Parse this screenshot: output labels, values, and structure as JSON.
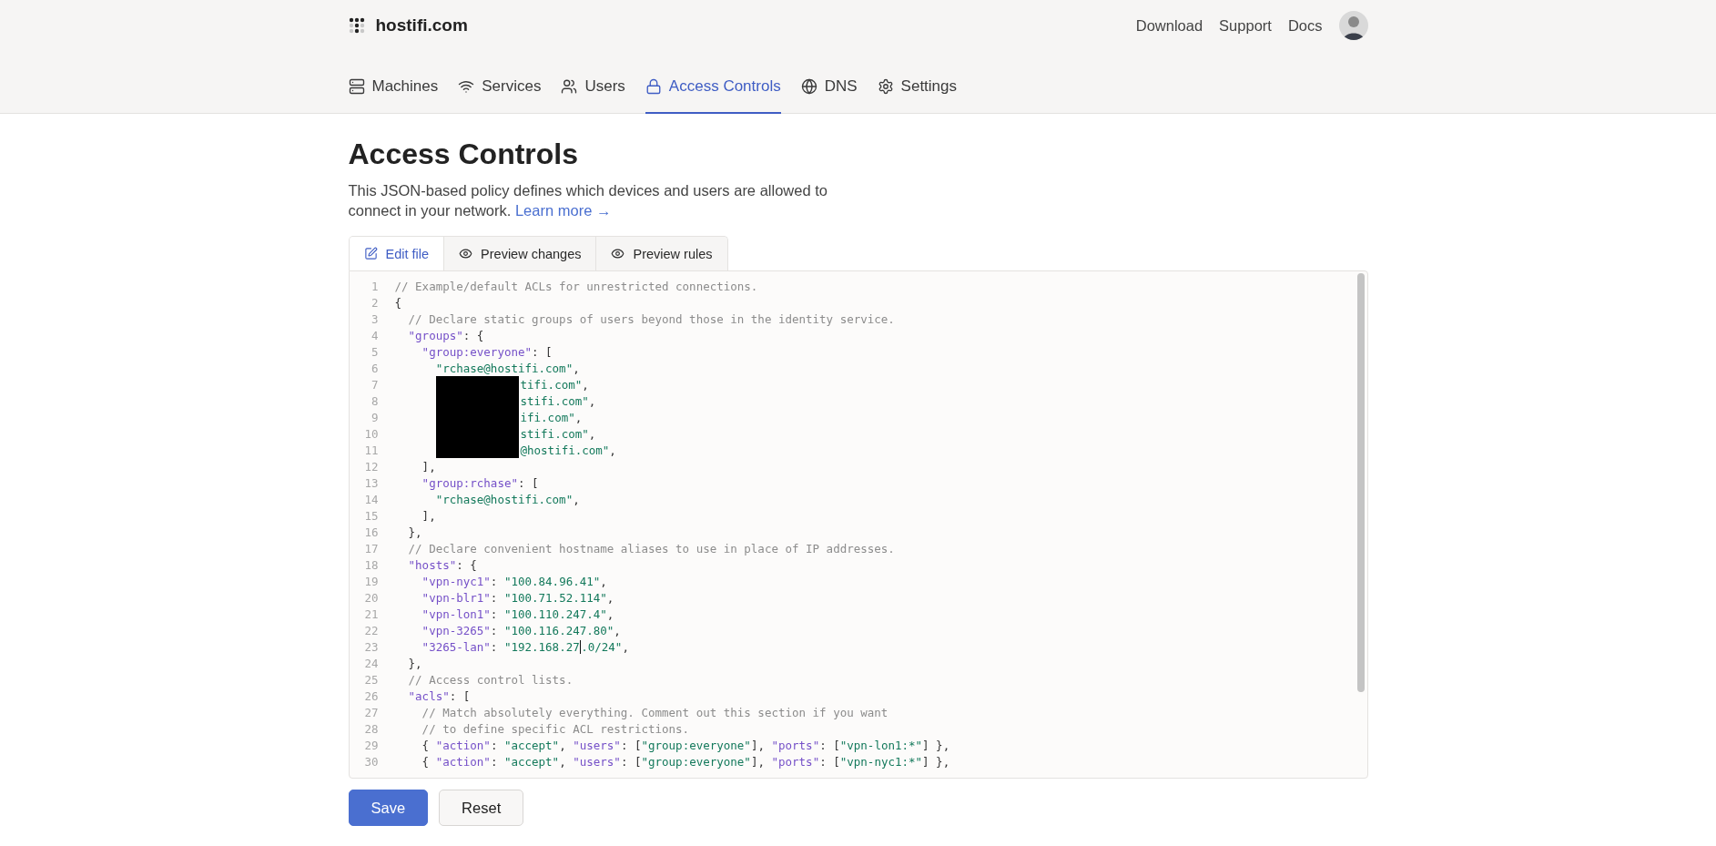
{
  "brand": {
    "name": "hostifi.com"
  },
  "top_links": [
    "Download",
    "Support",
    "Docs"
  ],
  "nav": [
    {
      "label": "Machines",
      "selected": false
    },
    {
      "label": "Services",
      "selected": false
    },
    {
      "label": "Users",
      "selected": false
    },
    {
      "label": "Access Controls",
      "selected": true
    },
    {
      "label": "DNS",
      "selected": false
    },
    {
      "label": "Settings",
      "selected": false
    }
  ],
  "page": {
    "title": "Access Controls",
    "description": "This JSON-based policy defines which devices and users are allowed to connect in your network.",
    "link": "Learn more →"
  },
  "editor_tabs": [
    {
      "label": "Edit file",
      "selected": true
    },
    {
      "label": "Preview changes",
      "selected": false
    },
    {
      "label": "Preview rules",
      "selected": false
    }
  ],
  "code_lines": [
    {
      "number": "1",
      "redacted": false,
      "segments": [
        {
          "kind": "comment",
          "text": "// Example/default ACLs for unrestricted connections."
        }
      ]
    },
    {
      "number": "2",
      "redacted": false,
      "segments": [
        {
          "kind": "punct",
          "text": "{"
        }
      ]
    },
    {
      "number": "3",
      "redacted": false,
      "segments": [
        {
          "kind": "comment",
          "text": "  // Declare static groups of users beyond those in the identity service."
        }
      ]
    },
    {
      "number": "4",
      "redacted": false,
      "segments": [
        {
          "kind": "key",
          "text": "  \"groups\""
        },
        {
          "kind": "punct",
          "text": ": {"
        }
      ]
    },
    {
      "number": "5",
      "redacted": false,
      "segments": [
        {
          "kind": "key",
          "text": "    \"group:everyone\""
        },
        {
          "kind": "punct",
          "text": ": ["
        }
      ]
    },
    {
      "number": "6",
      "redacted": false,
      "segments": [
        {
          "kind": "string",
          "text": "      \"rchase@hostifi.com\""
        },
        {
          "kind": "punct",
          "text": ","
        }
      ]
    },
    {
      "number": "7",
      "redacted": true,
      "segments": [
        {
          "kind": "string",
          "text": "tifi.com\""
        },
        {
          "kind": "punct",
          "text": ","
        }
      ]
    },
    {
      "number": "8",
      "redacted": true,
      "segments": [
        {
          "kind": "string",
          "text": "stifi.com\""
        },
        {
          "kind": "punct",
          "text": ","
        }
      ]
    },
    {
      "number": "9",
      "redacted": true,
      "segments": [
        {
          "kind": "string",
          "text": "ifi.com\""
        },
        {
          "kind": "punct",
          "text": ","
        }
      ]
    },
    {
      "number": "10",
      "redacted": true,
      "segments": [
        {
          "kind": "string",
          "text": "stifi.com\""
        },
        {
          "kind": "punct",
          "text": ","
        }
      ]
    },
    {
      "number": "11",
      "redacted": true,
      "segments": [
        {
          "kind": "string",
          "text": "@hostifi.com\""
        },
        {
          "kind": "punct",
          "text": ","
        }
      ]
    },
    {
      "number": "12",
      "redacted": false,
      "segments": [
        {
          "kind": "punct",
          "text": "    ],"
        }
      ]
    },
    {
      "number": "13",
      "redacted": false,
      "segments": [
        {
          "kind": "key",
          "text": "    \"group:rchase\""
        },
        {
          "kind": "punct",
          "text": ": ["
        }
      ]
    },
    {
      "number": "14",
      "redacted": false,
      "segments": [
        {
          "kind": "string",
          "text": "      \"rchase@hostifi.com\""
        },
        {
          "kind": "punct",
          "text": ","
        }
      ]
    },
    {
      "number": "15",
      "redacted": false,
      "segments": [
        {
          "kind": "punct",
          "text": "    ],"
        }
      ]
    },
    {
      "number": "16",
      "redacted": false,
      "segments": [
        {
          "kind": "punct",
          "text": "  },"
        }
      ]
    },
    {
      "number": "17",
      "redacted": false,
      "segments": [
        {
          "kind": "comment",
          "text": "  // Declare convenient hostname aliases to use in place of IP addresses."
        }
      ]
    },
    {
      "number": "18",
      "redacted": false,
      "segments": [
        {
          "kind": "key",
          "text": "  \"hosts\""
        },
        {
          "kind": "punct",
          "text": ": {"
        }
      ]
    },
    {
      "number": "19",
      "redacted": false,
      "segments": [
        {
          "kind": "key",
          "text": "    \"vpn-nyc1\""
        },
        {
          "kind": "punct",
          "text": ": "
        },
        {
          "kind": "string",
          "text": "\"100.84.96.41\""
        },
        {
          "kind": "punct",
          "text": ","
        }
      ]
    },
    {
      "number": "20",
      "redacted": false,
      "segments": [
        {
          "kind": "key",
          "text": "    \"vpn-blr1\""
        },
        {
          "kind": "punct",
          "text": ": "
        },
        {
          "kind": "string",
          "text": "\"100.71.52.114\""
        },
        {
          "kind": "punct",
          "text": ","
        }
      ]
    },
    {
      "number": "21",
      "redacted": false,
      "segments": [
        {
          "kind": "key",
          "text": "    \"vpn-lon1\""
        },
        {
          "kind": "punct",
          "text": ": "
        },
        {
          "kind": "string",
          "text": "\"100.110.247.4\""
        },
        {
          "kind": "punct",
          "text": ","
        }
      ]
    },
    {
      "number": "22",
      "redacted": false,
      "segments": [
        {
          "kind": "key",
          "text": "    \"vpn-3265\""
        },
        {
          "kind": "punct",
          "text": ": "
        },
        {
          "kind": "string",
          "text": "\"100.116.247.80\""
        },
        {
          "kind": "punct",
          "text": ","
        }
      ]
    },
    {
      "number": "23",
      "redacted": false,
      "segments": [
        {
          "kind": "key",
          "text": "    \"3265-lan\""
        },
        {
          "kind": "punct",
          "text": ": "
        },
        {
          "kind": "string",
          "text": "\"192.168.27"
        },
        {
          "kind": "caret"
        },
        {
          "kind": "string",
          "text": ".0/24\""
        },
        {
          "kind": "punct",
          "text": ","
        }
      ]
    },
    {
      "number": "24",
      "redacted": false,
      "segments": [
        {
          "kind": "punct",
          "text": "  },"
        }
      ]
    },
    {
      "number": "25",
      "redacted": false,
      "segments": [
        {
          "kind": "comment",
          "text": "  // Access control lists."
        }
      ]
    },
    {
      "number": "26",
      "redacted": false,
      "segments": [
        {
          "kind": "key",
          "text": "  \"acls\""
        },
        {
          "kind": "punct",
          "text": ": ["
        }
      ]
    },
    {
      "number": "27",
      "redacted": false,
      "segments": [
        {
          "kind": "comment",
          "text": "    // Match absolutely everything. Comment out this section if you want"
        }
      ]
    },
    {
      "number": "28",
      "redacted": false,
      "segments": [
        {
          "kind": "comment",
          "text": "    // to define specific ACL restrictions."
        }
      ]
    },
    {
      "number": "29",
      "redacted": false,
      "segments": [
        {
          "kind": "punct",
          "text": "    { "
        },
        {
          "kind": "key",
          "text": "\"action\""
        },
        {
          "kind": "punct",
          "text": ": "
        },
        {
          "kind": "string",
          "text": "\"accept\""
        },
        {
          "kind": "punct",
          "text": ", "
        },
        {
          "kind": "key",
          "text": "\"users\""
        },
        {
          "kind": "punct",
          "text": ": ["
        },
        {
          "kind": "string",
          "text": "\"group:everyone\""
        },
        {
          "kind": "punct",
          "text": "], "
        },
        {
          "kind": "key",
          "text": "\"ports\""
        },
        {
          "kind": "punct",
          "text": ": ["
        },
        {
          "kind": "string",
          "text": "\"vpn-lon1:*\""
        },
        {
          "kind": "punct",
          "text": "] },"
        }
      ]
    },
    {
      "number": "30",
      "redacted": false,
      "segments": [
        {
          "kind": "punct",
          "text": "    { "
        },
        {
          "kind": "key",
          "text": "\"action\""
        },
        {
          "kind": "punct",
          "text": ": "
        },
        {
          "kind": "string",
          "text": "\"accept\""
        },
        {
          "kind": "punct",
          "text": ", "
        },
        {
          "kind": "key",
          "text": "\"users\""
        },
        {
          "kind": "punct",
          "text": ": ["
        },
        {
          "kind": "string",
          "text": "\"group:everyone\""
        },
        {
          "kind": "punct",
          "text": "], "
        },
        {
          "kind": "key",
          "text": "\"ports\""
        },
        {
          "kind": "punct",
          "text": ": ["
        },
        {
          "kind": "string",
          "text": "\"vpn-nyc1:*\""
        },
        {
          "kind": "punct",
          "text": "] },"
        }
      ]
    }
  ],
  "buttons": [
    {
      "label": "Save",
      "kind": "primary"
    },
    {
      "label": "Reset",
      "kind": "secondary"
    }
  ]
}
